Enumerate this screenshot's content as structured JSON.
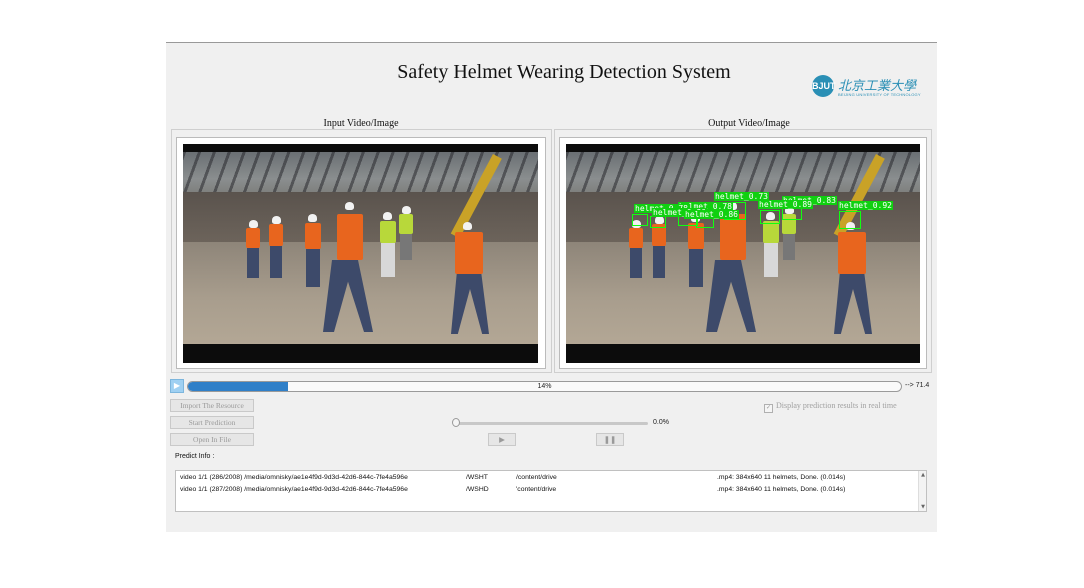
{
  "window": {
    "title": "Safety Helmet Wearing Detection System",
    "logo": {
      "badge": "BJUT",
      "name": "北京工業大學",
      "sub": "BEIJING UNIVERSITY OF TECHNOLOGY"
    }
  },
  "panels": {
    "input_label": "Input Video/Image",
    "output_label": "Output Video/Image"
  },
  "detections": [
    {
      "label": "helmet_0.73"
    },
    {
      "label": "helmet_0.83"
    },
    {
      "label": "helmet_0.78"
    },
    {
      "label": "helmet_0.89"
    },
    {
      "label": "helmet_0.92"
    },
    {
      "label": "helmet_0.78"
    },
    {
      "label": "helmet_0.86"
    },
    {
      "label": "helmet_0.86"
    }
  ],
  "progress": {
    "value": 0.14,
    "text": "14%",
    "end_text": "--> 71.4"
  },
  "controls": {
    "import_label": "Import The Resource",
    "start_label": "Start Prediction",
    "open_label": "Open In File",
    "play_label": "▶",
    "pause_label": "❚❚",
    "display_realtime_label": "Display prediction results in real time",
    "display_realtime_checked": true,
    "slider_value_text": "0.0%",
    "slider_value": 0.0
  },
  "predict": {
    "label": "Predict Info :",
    "lines": [
      {
        "a": "video 1/1 (286/2008) /media/omnisky/ae1e4f9d-9d3d-42d6-844c-7fe4a596e",
        "b": "/WSHT",
        "c": "/content/drive",
        "d": ".mp4: 384x640 11 helmets, Done. (0.014s)"
      },
      {
        "a": "video 1/1 (287/2008) /media/omnisky/ae1e4f9d-9d3d-42d6-844c-7fe4a596e",
        "b": "/WSHD",
        "c": "'content/drive",
        "d": ".mp4: 384x640 11 helmets, Done. (0.014s)"
      }
    ]
  },
  "colors": {
    "accent": "#2f7fc8",
    "detection": "#10ff10",
    "vest": "#e8651e"
  }
}
